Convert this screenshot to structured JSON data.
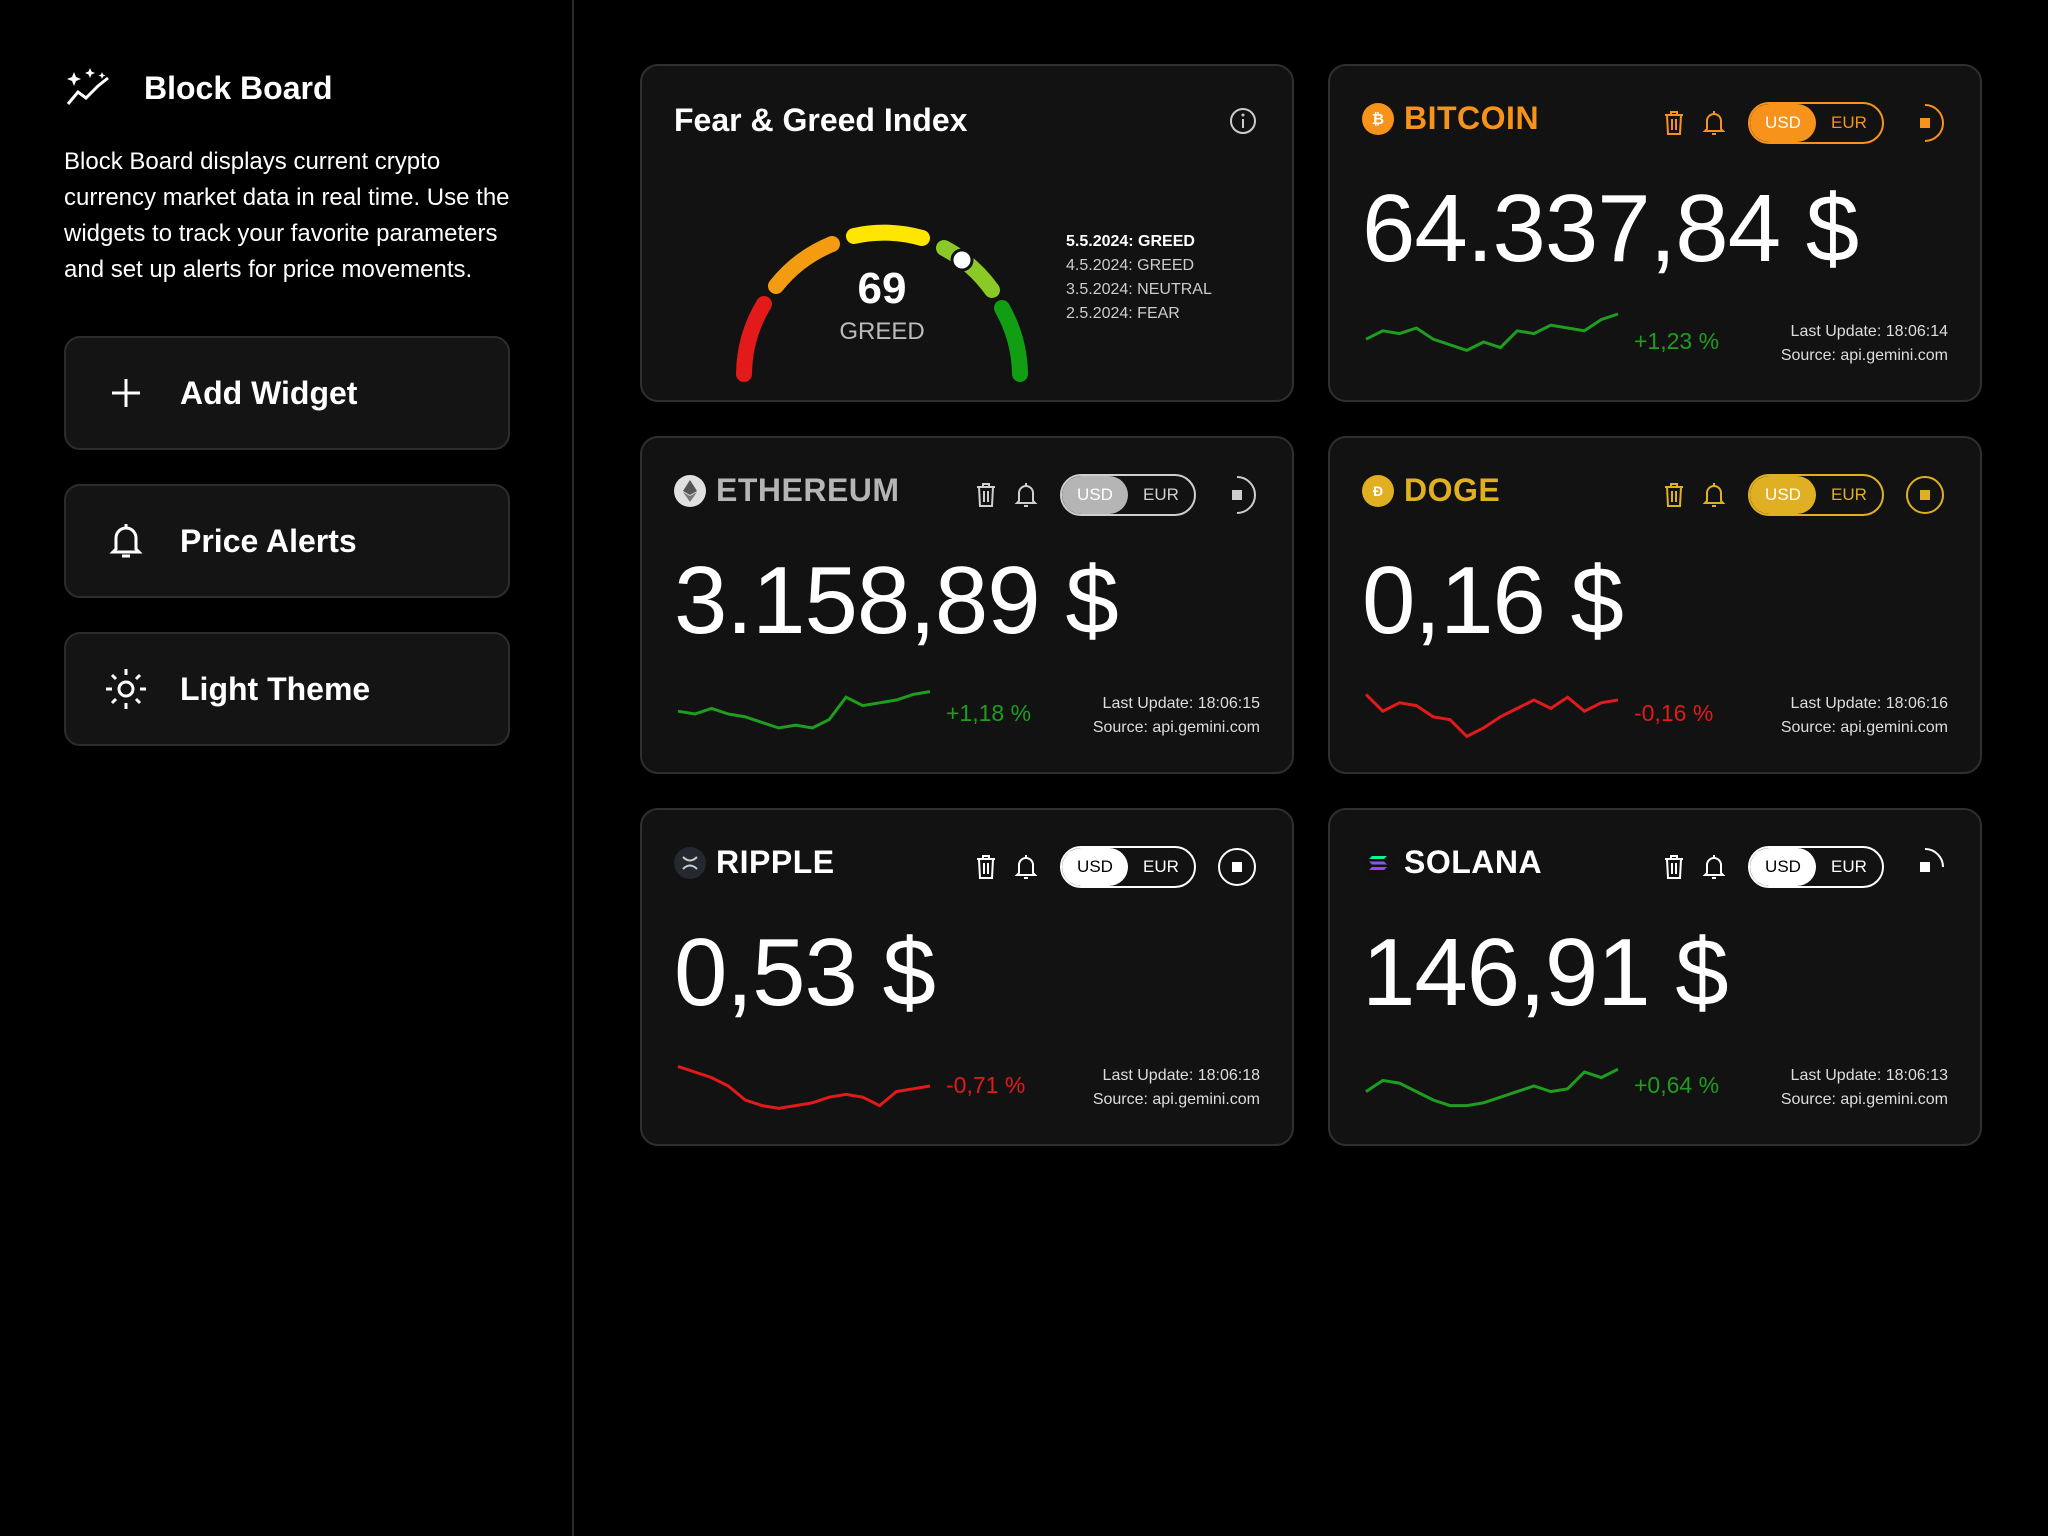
{
  "sidebar": {
    "brand": "Block Board",
    "intro": "Block Board displays current crypto currency market data in real time. Use the widgets to track your favorite parameters and set up alerts for price movements.",
    "buttons": [
      {
        "label": "Add Widget",
        "icon": "plus-icon"
      },
      {
        "label": "Price Alerts",
        "icon": "bell-icon"
      },
      {
        "label": "Light Theme",
        "icon": "sun-icon"
      }
    ]
  },
  "fear_greed": {
    "title": "Fear & Greed Index",
    "value": "69",
    "label": "GREED",
    "history": [
      "5.5.2024: GREED",
      "4.5.2024: GREED",
      "3.5.2024: NEUTRAL",
      "2.5.2024: FEAR"
    ]
  },
  "currency_options": {
    "usd": "USD",
    "eur": "EUR"
  },
  "meta_labels": {
    "last_update": "Last Update:",
    "source": "Source:"
  },
  "coins": [
    {
      "name": "BITCOIN",
      "price": "64.337,84 $",
      "change": "+1,23 %",
      "update": "Last Update: 18:06:14",
      "source": "Source: api.gemini.com",
      "accent": "#f7931a",
      "trend": "up",
      "spark": [
        18,
        12,
        14,
        10,
        18,
        22,
        26,
        20,
        24,
        12,
        14,
        8,
        10,
        12,
        4,
        0
      ],
      "selected": "USD"
    },
    {
      "name": "ETHEREUM",
      "price": "3.158,89 $",
      "change": "+1,18 %",
      "update": "Last Update: 18:06:15",
      "source": "Source: api.gemini.com",
      "accent": "#b5b5b5",
      "trend": "up",
      "spark": [
        18,
        20,
        16,
        20,
        22,
        26,
        30,
        28,
        30,
        24,
        8,
        14,
        12,
        10,
        6,
        4
      ],
      "selected": "USD"
    },
    {
      "name": "DOGE",
      "price": "0,16 $",
      "change": "-0,16 %",
      "update": "Last Update: 18:06:16",
      "source": "Source: api.gemini.com",
      "accent": "#e1b022",
      "trend": "down",
      "spark": [
        6,
        18,
        12,
        14,
        22,
        24,
        36,
        30,
        22,
        16,
        10,
        16,
        8,
        18,
        12,
        10
      ],
      "selected": "USD"
    },
    {
      "name": "RIPPLE",
      "price": "0,53 $",
      "change": "-0,71 %",
      "update": "Last Update: 18:06:18",
      "source": "Source: api.gemini.com",
      "accent": "#ffffff",
      "trend": "down",
      "spark": [
        6,
        10,
        14,
        20,
        30,
        34,
        36,
        34,
        32,
        28,
        26,
        28,
        34,
        24,
        22,
        20
      ],
      "selected": "USD"
    },
    {
      "name": "SOLANA",
      "price": "146,91 $",
      "change": "+0,64 %",
      "update": "Last Update: 18:06:13",
      "source": "Source: api.gemini.com",
      "accent": "#ffffff",
      "trend": "up",
      "spark": [
        24,
        16,
        18,
        24,
        30,
        34,
        34,
        32,
        28,
        24,
        20,
        24,
        22,
        10,
        14,
        8
      ],
      "selected": "USD"
    }
  ],
  "colors": {
    "up": "#1f9d1f",
    "down": "#e31a1a",
    "card": "#121212"
  }
}
